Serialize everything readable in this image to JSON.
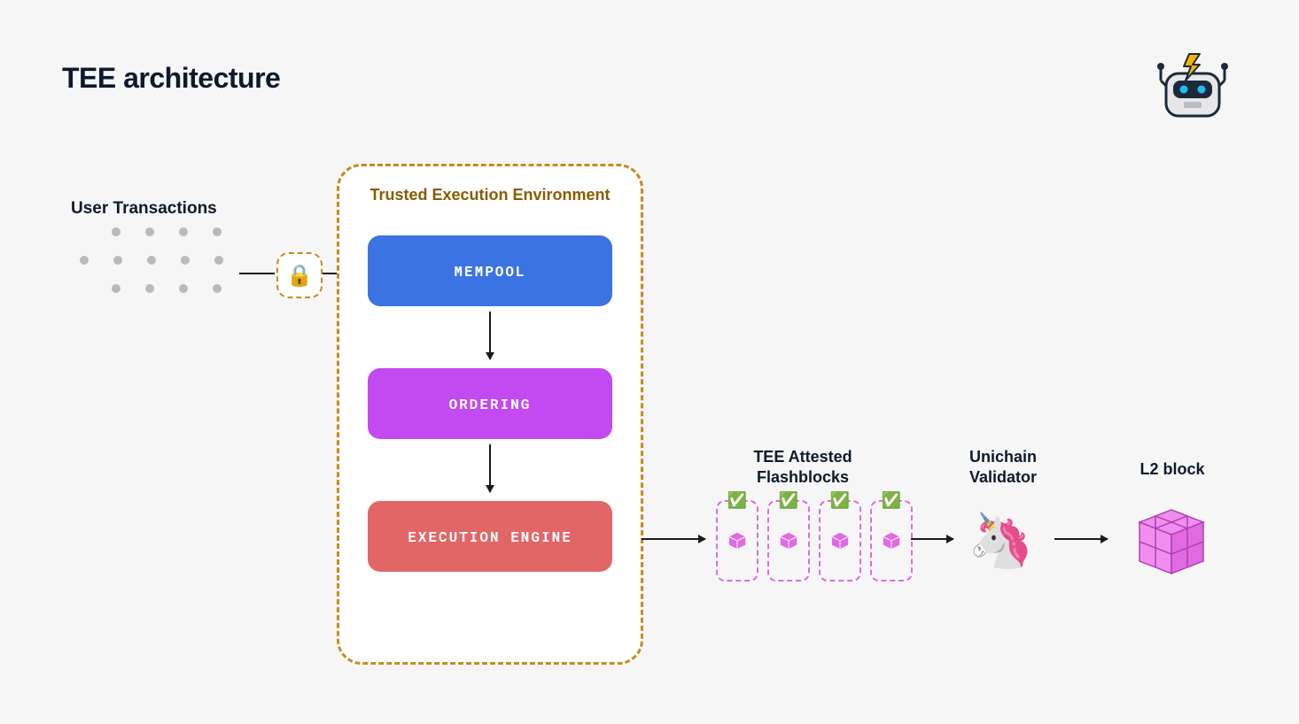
{
  "title": "TEE architecture",
  "user_tx_label": "User Transactions",
  "tee": {
    "label": "Trusted Execution Environment",
    "stages": {
      "mempool": "MEMPOOL",
      "ordering": "ORDERING",
      "exec": "EXECUTION ENGINE"
    }
  },
  "flashblocks": {
    "label": "TEE Attested Flashblocks",
    "count": 4
  },
  "unichain": {
    "label": "Unichain Validator"
  },
  "l2": {
    "label": "L2 block"
  },
  "colors": {
    "mempool": "#3c73e3",
    "ordering": "#c24af0",
    "exec": "#e26666",
    "tee_border": "#c98a1a",
    "flashblock_border": "#e06be0",
    "cube_fill": "#e06be0"
  },
  "icons": {
    "lock": "lock-icon",
    "check": "checkmark-icon",
    "cube": "cube-icon",
    "unicorn": "unicorn-icon",
    "robot": "robot-mascot-icon"
  }
}
